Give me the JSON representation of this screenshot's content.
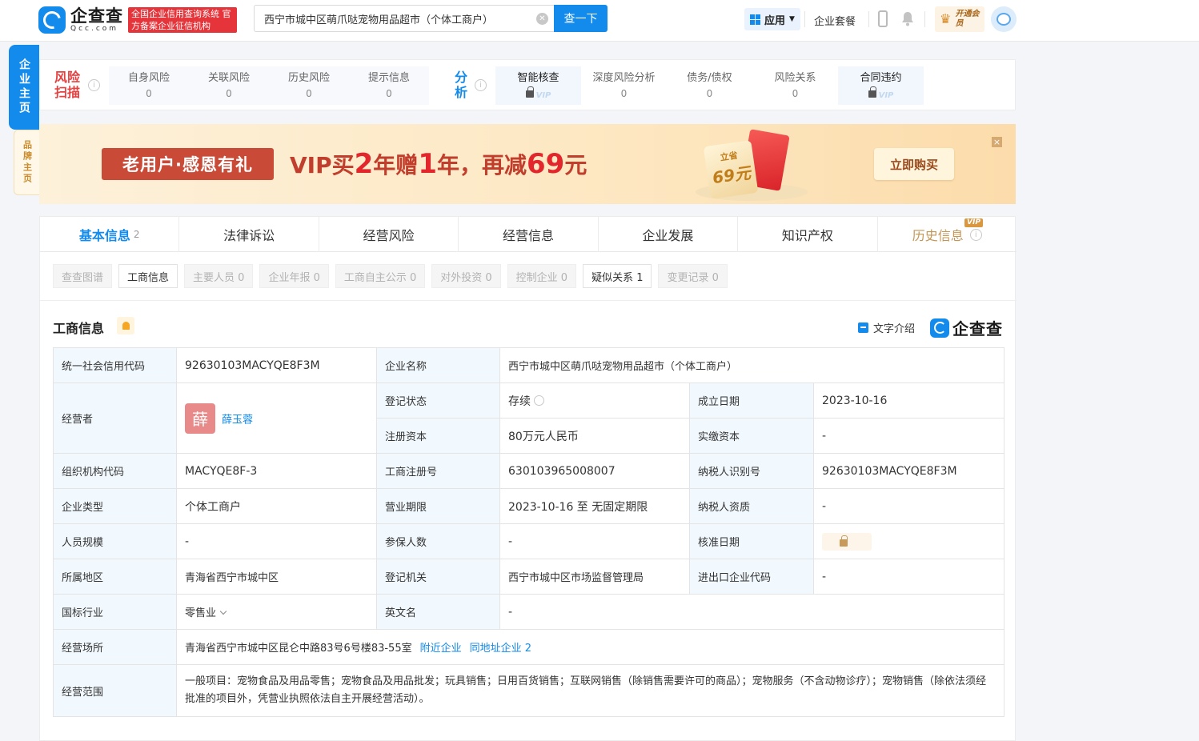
{
  "header": {
    "logo_cn": "企查查",
    "logo_en": "Qcc.com",
    "logo_badge": "全国企业信用查询系统 官方备案企业征信机构",
    "search_value": "西宁市城中区萌爪哒宠物用品超市（个体工商户）",
    "search_button": "查一下",
    "app_label": "应用",
    "nav_package": "企业套餐",
    "vip_label": "开通会员"
  },
  "side": {
    "main_tab": "企业主页",
    "brand_tab": "品牌主页"
  },
  "risk": {
    "scan_label": "风险扫描",
    "scan_items": [
      {
        "name": "自身风险",
        "value": "0"
      },
      {
        "name": "关联风险",
        "value": "0"
      },
      {
        "name": "历史风险",
        "value": "0"
      },
      {
        "name": "提示信息",
        "value": "0"
      }
    ],
    "analysis_label": "分析",
    "analysis_items": [
      {
        "name": "智能核查",
        "value": "",
        "locked": true
      },
      {
        "name": "深度风险分析",
        "value": "0"
      },
      {
        "name": "债务/债权",
        "value": "0"
      },
      {
        "name": "风险关系",
        "value": "0"
      },
      {
        "name": "合同违约",
        "value": "",
        "locked": true
      }
    ]
  },
  "banner": {
    "tag": "老用户·感恩有礼",
    "text_1": "VIP买",
    "num_1": "2",
    "text_2": "年赠",
    "num_2": "1",
    "text_3": "年，再减",
    "num_3": "69",
    "text_4": "元",
    "gift_top": "立省",
    "gift_amount": "69元",
    "buy_button": "立即购买",
    "close": "×"
  },
  "tabs": [
    {
      "label": "基本信息",
      "count": "2",
      "active": true
    },
    {
      "label": "法律诉讼",
      "count": ""
    },
    {
      "label": "经营风险",
      "count": ""
    },
    {
      "label": "经营信息",
      "count": ""
    },
    {
      "label": "企业发展",
      "count": ""
    },
    {
      "label": "知识产权",
      "count": ""
    },
    {
      "label": "历史信息",
      "count": "",
      "vip": "VIP"
    }
  ],
  "subtabs": [
    {
      "label": "查查图谱",
      "enabled": false
    },
    {
      "label": "工商信息",
      "enabled": true
    },
    {
      "label": "主要人员 0",
      "enabled": false
    },
    {
      "label": "企业年报 0",
      "enabled": false
    },
    {
      "label": "工商自主公示 0",
      "enabled": false
    },
    {
      "label": "对外投资 0",
      "enabled": false
    },
    {
      "label": "控制企业 0",
      "enabled": false
    },
    {
      "label": "疑似关系 1",
      "enabled": true
    },
    {
      "label": "变更记录 0",
      "enabled": false
    }
  ],
  "section": {
    "title": "工商信息",
    "text_intro": "文字介绍",
    "brand": "企查查"
  },
  "info": {
    "credit_code_label": "统一社会信用代码",
    "credit_code": "92630103MACYQE8F3M",
    "company_name_label": "企业名称",
    "company_name": "西宁市城中区萌爪哒宠物用品超市（个体工商户）",
    "operator_label": "经营者",
    "operator_avatar": "薛",
    "operator_name": "薛玉蓉",
    "reg_status_label": "登记状态",
    "reg_status": "存续",
    "est_date_label": "成立日期",
    "est_date": "2023-10-16",
    "reg_capital_label": "注册资本",
    "reg_capital": "80万元人民币",
    "paid_capital_label": "实缴资本",
    "paid_capital": "-",
    "org_code_label": "组织机构代码",
    "org_code": "MACYQE8F-3",
    "biz_reg_no_label": "工商注册号",
    "biz_reg_no": "630103965008007",
    "taxpayer_id_label": "纳税人识别号",
    "taxpayer_id": "92630103MACYQE8F3M",
    "ent_type_label": "企业类型",
    "ent_type": "个体工商户",
    "biz_term_label": "营业期限",
    "biz_term": "2023-10-16 至 无固定期限",
    "taxpayer_qual_label": "纳税人资质",
    "taxpayer_qual": "-",
    "staff_size_label": "人员规模",
    "staff_size": "-",
    "insured_label": "参保人数",
    "insured": "-",
    "approval_date_label": "核准日期",
    "region_label": "所属地区",
    "region": "青海省西宁市城中区",
    "reg_authority_label": "登记机关",
    "reg_authority": "西宁市城中区市场监督管理局",
    "import_export_label": "进出口企业代码",
    "import_export": "-",
    "industry_label": "国标行业",
    "industry": "零售业",
    "english_name_label": "英文名",
    "english_name": "-",
    "address_label": "经营场所",
    "address": "青海省西宁市城中区昆仑中路83号6号楼83-55室",
    "nearby_link": "附近企业",
    "same_addr_link": "同地址企业 2",
    "scope_label": "经营范围",
    "scope": "一般项目：宠物食品及用品零售；宠物食品及用品批发；玩具销售；日用百货销售；互联网销售（除销售需要许可的商品）；宠物服务（不含动物诊疗）；宠物销售（除依法须经批准的项目外，凭营业执照依法自主开展经营活动）。"
  },
  "colors": {
    "brand_blue": "#128bed",
    "risk_red": "#e64141",
    "banner_red": "#c84a37"
  }
}
